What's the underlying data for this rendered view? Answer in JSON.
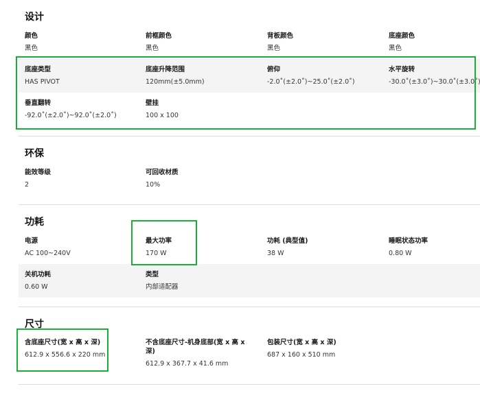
{
  "sections": {
    "design": {
      "title": "设计",
      "items": [
        {
          "label": "颜色",
          "value": "黑色"
        },
        {
          "label": "前框颜色",
          "value": "黑色"
        },
        {
          "label": "背板颜色",
          "value": "黑色"
        },
        {
          "label": "底座颜色",
          "value": "黑色"
        },
        {
          "label": "底座类型",
          "value": "HAS PIVOT"
        },
        {
          "label": "底座升降范围",
          "value": "120mm(±5.0mm)"
        },
        {
          "label": "俯仰",
          "value": "-2.0˚(±2.0˚)~25.0˚(±2.0˚)"
        },
        {
          "label": "水平旋转",
          "value": "-30.0˚(±3.0˚)~30.0˚(±3.0˚)"
        },
        {
          "label": "垂直翻转",
          "value": "-92.0˚(±2.0˚)~92.0˚(±2.0˚)"
        },
        {
          "label": "壁挂",
          "value": "100 x 100"
        }
      ]
    },
    "eco": {
      "title": "环保",
      "items": [
        {
          "label": "能效等级",
          "value": "2"
        },
        {
          "label": "可回收材质",
          "value": "10%"
        }
      ]
    },
    "power": {
      "title": "功耗",
      "items": [
        {
          "label": "电源",
          "value": "AC 100~240V"
        },
        {
          "label": "最大功率",
          "value": "170 W"
        },
        {
          "label": "功耗 (典型值)",
          "value": "38 W"
        },
        {
          "label": "睡眠状态功率",
          "value": "0.80 W"
        },
        {
          "label": "关机功耗",
          "value": "0.60 W"
        },
        {
          "label": "类型",
          "value": "内部适配器"
        }
      ]
    },
    "dimensions": {
      "title": "尺寸",
      "items": [
        {
          "label": "含底座尺寸(宽 x 高 x 深)",
          "value": "612.9 x 556.6 x 220 mm"
        },
        {
          "label": "不含底座尺寸-机身底部(宽 x 高 x 深)",
          "value": "612.9 x 367.7 x 41.6 mm"
        },
        {
          "label": "包装尺寸(宽 x 高 x 深)",
          "value": "687 x 160 x 510 mm"
        }
      ]
    }
  }
}
